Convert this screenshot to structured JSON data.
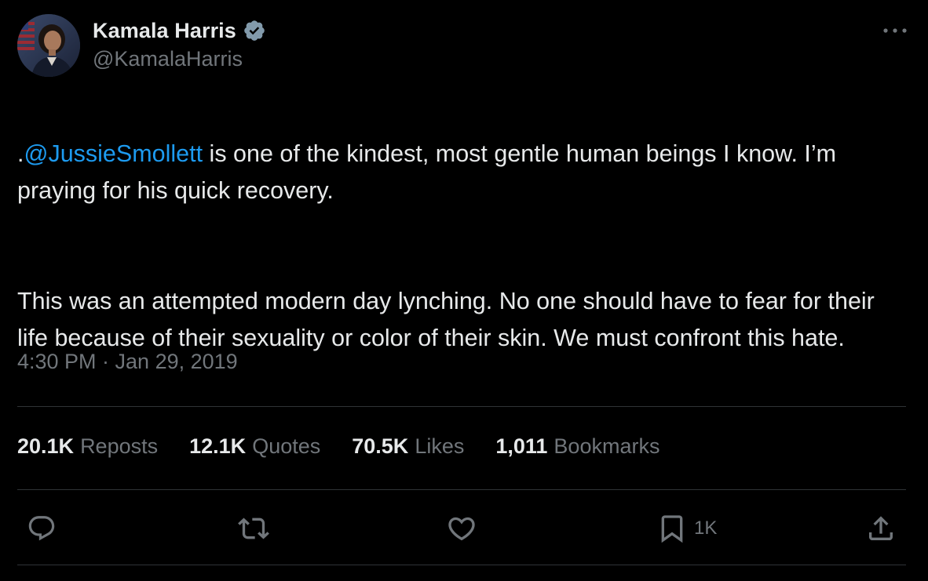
{
  "tweet": {
    "author": {
      "display_name": "Kamala Harris",
      "handle": "@KamalaHarris",
      "verified": true
    },
    "text": {
      "prefix": ".",
      "mention": "@JussieSmollett",
      "line1_rest": " is one of the kindest, most gentle human beings I know. I’m praying for his quick recovery.",
      "paragraph2": "This was an attempted modern day lynching. No one should have to fear for their life because of their sexuality or color of their skin. We must confront this hate."
    },
    "timestamp": "4:30 PM · Jan 29, 2019",
    "stats": {
      "reposts": {
        "count": "20.1K",
        "label": "Reposts"
      },
      "quotes": {
        "count": "12.1K",
        "label": "Quotes"
      },
      "likes": {
        "count": "70.5K",
        "label": "Likes"
      },
      "bookmarks": {
        "count": "1,011",
        "label": "Bookmarks"
      }
    },
    "actions": {
      "bookmark_count": "1K"
    }
  },
  "colors": {
    "background": "#000000",
    "text": "#e7e9ea",
    "muted": "#71767b",
    "accent": "#1d9bf0",
    "divider": "#2f3336"
  },
  "icons": [
    "verified-badge-icon",
    "more-icon",
    "reply-icon",
    "repost-icon",
    "like-icon",
    "bookmark-icon",
    "share-icon"
  ]
}
